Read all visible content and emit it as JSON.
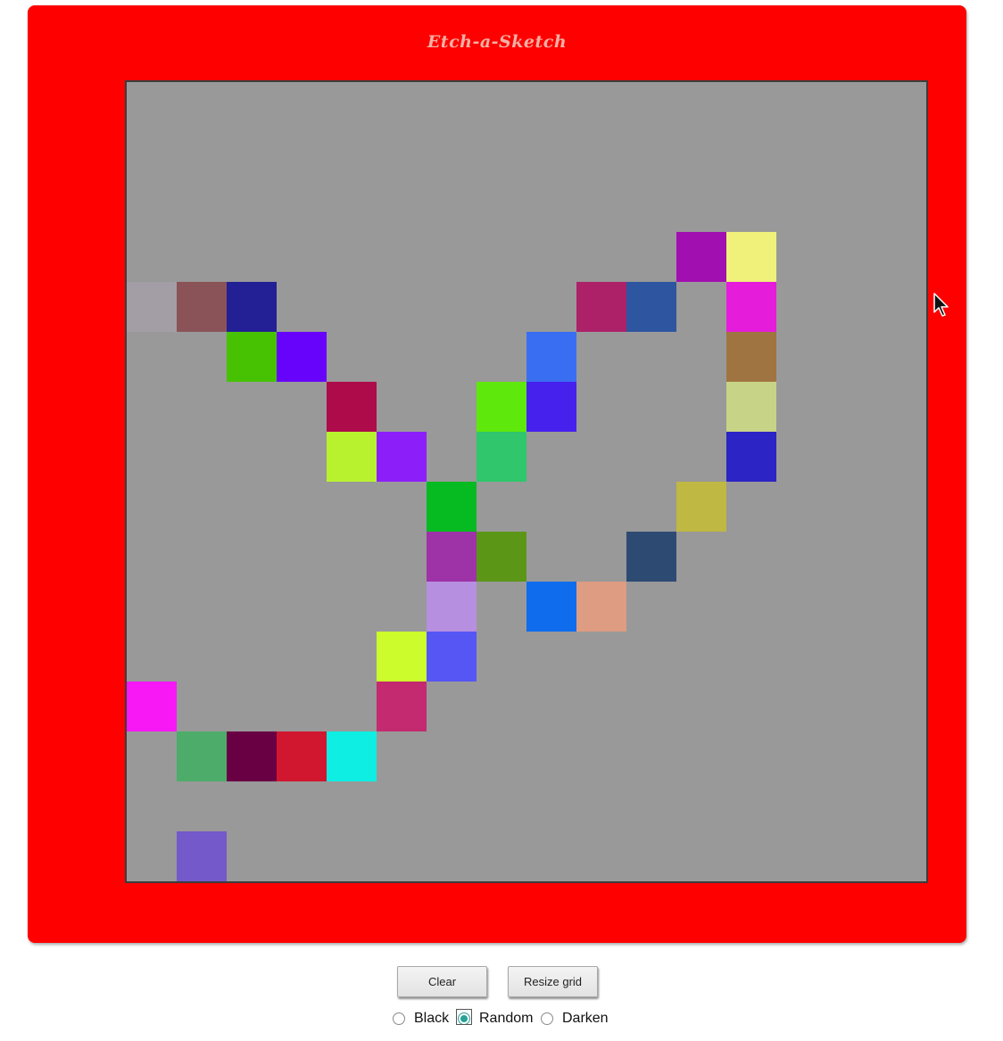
{
  "app": {
    "title": "Etch-a-Sketch"
  },
  "colors": {
    "frame": "#ff0000",
    "grid_background": "#999999"
  },
  "grid": {
    "size": 16,
    "painted_cells": [
      {
        "row": 3,
        "col": 11,
        "color": "#a20fb0"
      },
      {
        "row": 3,
        "col": 12,
        "color": "#eff17a"
      },
      {
        "row": 4,
        "col": 0,
        "color": "#a39ea6"
      },
      {
        "row": 4,
        "col": 1,
        "color": "#8a5357"
      },
      {
        "row": 4,
        "col": 2,
        "color": "#231f94"
      },
      {
        "row": 4,
        "col": 9,
        "color": "#ad2169"
      },
      {
        "row": 4,
        "col": 10,
        "color": "#2e55a0"
      },
      {
        "row": 4,
        "col": 12,
        "color": "#e61cdb"
      },
      {
        "row": 5,
        "col": 2,
        "color": "#46c203"
      },
      {
        "row": 5,
        "col": 3,
        "color": "#6803fb"
      },
      {
        "row": 5,
        "col": 8,
        "color": "#3a6ef2"
      },
      {
        "row": 5,
        "col": 12,
        "color": "#a07440"
      },
      {
        "row": 6,
        "col": 4,
        "color": "#ad0b4a"
      },
      {
        "row": 6,
        "col": 7,
        "color": "#5fe80c"
      },
      {
        "row": 6,
        "col": 8,
        "color": "#4621ee"
      },
      {
        "row": 6,
        "col": 12,
        "color": "#c7d387"
      },
      {
        "row": 7,
        "col": 4,
        "color": "#b8f22f"
      },
      {
        "row": 7,
        "col": 5,
        "color": "#8c1ff9"
      },
      {
        "row": 7,
        "col": 7,
        "color": "#2fc66c"
      },
      {
        "row": 7,
        "col": 12,
        "color": "#2c24c4"
      },
      {
        "row": 8,
        "col": 6,
        "color": "#06ba22"
      },
      {
        "row": 8,
        "col": 11,
        "color": "#bfb843"
      },
      {
        "row": 9,
        "col": 6,
        "color": "#9d33a7"
      },
      {
        "row": 9,
        "col": 7,
        "color": "#5b9617"
      },
      {
        "row": 9,
        "col": 10,
        "color": "#2d4b72"
      },
      {
        "row": 10,
        "col": 6,
        "color": "#b78fe0"
      },
      {
        "row": 10,
        "col": 8,
        "color": "#0e6ced"
      },
      {
        "row": 10,
        "col": 9,
        "color": "#de9c82"
      },
      {
        "row": 11,
        "col": 5,
        "color": "#cdfc2c"
      },
      {
        "row": 11,
        "col": 6,
        "color": "#5556f4"
      },
      {
        "row": 12,
        "col": 0,
        "color": "#f818f6"
      },
      {
        "row": 12,
        "col": 5,
        "color": "#c32a6f"
      },
      {
        "row": 13,
        "col": 1,
        "color": "#4dac6a"
      },
      {
        "row": 13,
        "col": 2,
        "color": "#6a0044"
      },
      {
        "row": 13,
        "col": 3,
        "color": "#d1172f"
      },
      {
        "row": 13,
        "col": 4,
        "color": "#0eeee3"
      },
      {
        "row": 15,
        "col": 1,
        "color": "#7359c9"
      }
    ]
  },
  "controls": {
    "clear_label": "Clear",
    "resize_label": "Resize grid"
  },
  "modes": {
    "selected": "Random",
    "options": [
      {
        "label": "Black",
        "checked": false
      },
      {
        "label": "Random",
        "checked": true
      },
      {
        "label": "Darken",
        "checked": false
      }
    ]
  },
  "icons": {
    "cursor": "arrow-cursor-icon"
  }
}
